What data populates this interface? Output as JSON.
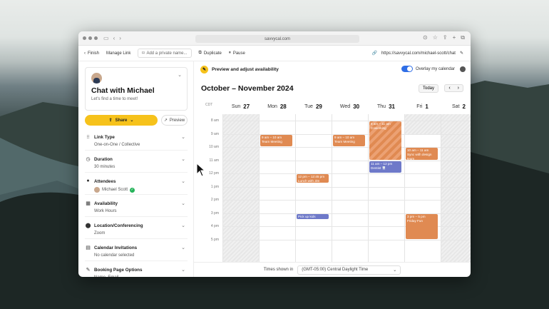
{
  "browser": {
    "url": "savvycal.com"
  },
  "appbar": {
    "finish": "Finish",
    "manage_link": "Manage Link",
    "add_private_name": "Add a private name...",
    "duplicate": "Duplicate",
    "pause": "Pause",
    "public_url": "https://savvycal.com/michael-scott/chat"
  },
  "card": {
    "title": "Chat with Michael",
    "subtitle": "Let's find a time to meet!",
    "share": "Share",
    "preview": "Preview"
  },
  "sections": [
    {
      "title": "Link Type",
      "value": "One-on-One / Collective",
      "icon": "link-type-icon"
    },
    {
      "title": "Duration",
      "value": "30 minutes",
      "icon": "clock-icon"
    },
    {
      "title": "Attendees",
      "value": "Michael Scott",
      "icon": "person-icon"
    },
    {
      "title": "Availability",
      "value": "Work Hours",
      "icon": "grid-icon"
    },
    {
      "title": "Location/Conferencing",
      "value": "Zoom",
      "icon": "location-pin-icon"
    },
    {
      "title": "Calendar Invitations",
      "value": "No calendar selected",
      "icon": "calendar-icon"
    },
    {
      "title": "Booking Page Options",
      "value": "Name, Email",
      "icon": "edit-icon"
    }
  ],
  "preview_bar": {
    "title": "Preview and adjust availability",
    "overlay_label": "Overlay my calendar",
    "overlay_on": true
  },
  "calendar": {
    "month": "October – November 2024",
    "today_label": "Today",
    "tz_short": "CDT",
    "days": [
      {
        "dow": "Sun",
        "num": "27"
      },
      {
        "dow": "Mon",
        "num": "28"
      },
      {
        "dow": "Tue",
        "num": "29"
      },
      {
        "dow": "Wed",
        "num": "30"
      },
      {
        "dow": "Thu",
        "num": "31"
      },
      {
        "dow": "Fri",
        "num": "1"
      },
      {
        "dow": "Sat",
        "num": "2"
      }
    ],
    "hours": [
      "8 am",
      "9 am",
      "10 am",
      "11 am",
      "12 pm",
      "1 pm",
      "2 pm",
      "3 pm",
      "4 pm",
      "5 pm"
    ],
    "events": [
      {
        "day": 1,
        "start": 9.0,
        "end": 10.0,
        "time": "9 am – 10 am",
        "title": "Team Meeting",
        "style": "o"
      },
      {
        "day": 3,
        "start": 9.0,
        "end": 10.0,
        "time": "9 am – 10 am",
        "title": "Team Meeting",
        "style": "o"
      },
      {
        "day": 4,
        "start": 8.0,
        "end": 11.0,
        "time": "8 am – 11 am",
        "title": "Coworking",
        "style": "stripe"
      },
      {
        "day": 4,
        "start": 11.0,
        "end": 12.0,
        "time": "11 am – 12 pm",
        "title": "Dentist 🦷",
        "style": "b"
      },
      {
        "day": 5,
        "start": 10.0,
        "end": 11.0,
        "time": "10 am – 11 am",
        "title": "Sync with design team",
        "style": "o"
      },
      {
        "day": 2,
        "start": 12.0,
        "end": 12.75,
        "time": "12 pm – 12:45 pm",
        "title": "Lunch with Jim",
        "style": "o"
      },
      {
        "day": 2,
        "start": 15.0,
        "end": 15.5,
        "time": "",
        "title": "Pick up kids",
        "style": "b"
      },
      {
        "day": 5,
        "start": 15.0,
        "end": 17.0,
        "time": "3 pm – 5 pm",
        "title": "Friday Fun",
        "style": "o"
      }
    ],
    "availability": [
      {
        "day": 1,
        "start": 7.5,
        "end": 17.0
      },
      {
        "day": 2,
        "start": 7.5,
        "end": 17.0
      },
      {
        "day": 3,
        "start": 7.5,
        "end": 17.0
      },
      {
        "day": 4,
        "start": 7.5,
        "end": 17.0
      },
      {
        "day": 5,
        "start": 9.0,
        "end": 17.0
      }
    ]
  },
  "footer": {
    "label": "Times shown in",
    "timezone": "(GMT-05:00) Central Daylight Time"
  }
}
